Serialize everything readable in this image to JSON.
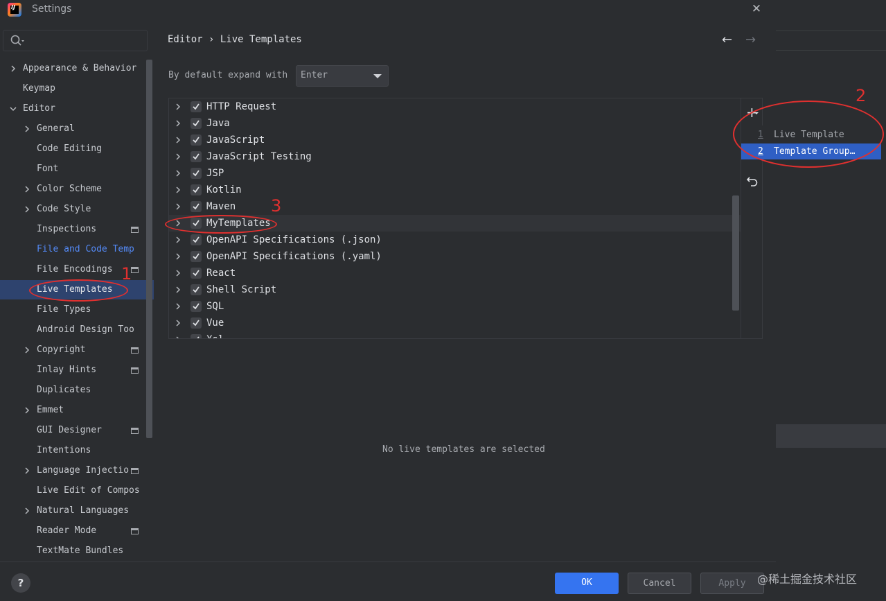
{
  "window": {
    "title": "Settings"
  },
  "sidebar": {
    "search_placeholder": "",
    "items": [
      {
        "label": "Appearance & Behavior",
        "expandable": true,
        "expanded": false,
        "level": 0
      },
      {
        "label": "Keymap",
        "expandable": false,
        "level": 0
      },
      {
        "label": "Editor",
        "expandable": true,
        "expanded": true,
        "level": 0
      },
      {
        "label": "General",
        "expandable": true,
        "expanded": false,
        "level": 1
      },
      {
        "label": "Code Editing",
        "expandable": false,
        "level": 1
      },
      {
        "label": "Font",
        "expandable": false,
        "level": 1
      },
      {
        "label": "Color Scheme",
        "expandable": true,
        "expanded": false,
        "level": 1
      },
      {
        "label": "Code Style",
        "expandable": true,
        "expanded": false,
        "level": 1
      },
      {
        "label": "Inspections",
        "expandable": false,
        "level": 1,
        "project_icon": true
      },
      {
        "label": "File and Code Temp",
        "expandable": false,
        "level": 1,
        "link": true
      },
      {
        "label": "File Encodings",
        "expandable": false,
        "level": 1,
        "project_icon": true
      },
      {
        "label": "Live Templates",
        "expandable": false,
        "level": 1,
        "selected": true
      },
      {
        "label": "File Types",
        "expandable": false,
        "level": 1
      },
      {
        "label": "Android Design Too",
        "expandable": false,
        "level": 1
      },
      {
        "label": "Copyright",
        "expandable": true,
        "expanded": false,
        "level": 1,
        "project_icon": true
      },
      {
        "label": "Inlay Hints",
        "expandable": false,
        "level": 1,
        "project_icon": true
      },
      {
        "label": "Duplicates",
        "expandable": false,
        "level": 1
      },
      {
        "label": "Emmet",
        "expandable": true,
        "expanded": false,
        "level": 1
      },
      {
        "label": "GUI Designer",
        "expandable": false,
        "level": 1,
        "project_icon": true
      },
      {
        "label": "Intentions",
        "expandable": false,
        "level": 1
      },
      {
        "label": "Language Injectio",
        "expandable": true,
        "expanded": false,
        "level": 1,
        "project_icon": true
      },
      {
        "label": "Live Edit of Compos",
        "expandable": false,
        "level": 1
      },
      {
        "label": "Natural Languages",
        "expandable": true,
        "expanded": false,
        "level": 1
      },
      {
        "label": "Reader Mode",
        "expandable": false,
        "level": 1,
        "project_icon": true
      },
      {
        "label": "TextMate Bundles",
        "expandable": false,
        "level": 1
      }
    ]
  },
  "content": {
    "breadcrumb": "Editor › Live Templates",
    "expand_label": "By default expand with",
    "expand_value": "Enter",
    "template_groups": [
      {
        "name": "HTTP Request",
        "checked": true
      },
      {
        "name": "Java",
        "checked": true
      },
      {
        "name": "JavaScript",
        "checked": true
      },
      {
        "name": "JavaScript Testing",
        "checked": true
      },
      {
        "name": "JSP",
        "checked": true
      },
      {
        "name": "Kotlin",
        "checked": true
      },
      {
        "name": "Maven",
        "checked": true
      },
      {
        "name": "MyTemplates",
        "checked": true,
        "highlighted": true
      },
      {
        "name": "OpenAPI Specifications (.json)",
        "checked": true
      },
      {
        "name": "OpenAPI Specifications (.yaml)",
        "checked": true
      },
      {
        "name": "React",
        "checked": true
      },
      {
        "name": "Shell Script",
        "checked": true
      },
      {
        "name": "SQL",
        "checked": true
      },
      {
        "name": "Vue",
        "checked": true
      },
      {
        "name": "Xsl",
        "checked": true
      }
    ],
    "empty_message": "No live templates are selected"
  },
  "add_popup": {
    "items": [
      {
        "num": "1",
        "label": "Live Template",
        "active": false
      },
      {
        "num": "2",
        "label": "Template Group…",
        "active": true
      }
    ]
  },
  "footer": {
    "help": "?",
    "ok": "OK",
    "cancel": "Cancel",
    "apply": "Apply"
  },
  "watermark": "@稀土掘金技术社区",
  "annotations": [
    "1",
    "2",
    "3"
  ],
  "colors": {
    "selection": "#2e436e",
    "accent": "#3574f0",
    "popup_active": "#2f5fc4",
    "annotation": "#e0302f",
    "link": "#548af7"
  }
}
